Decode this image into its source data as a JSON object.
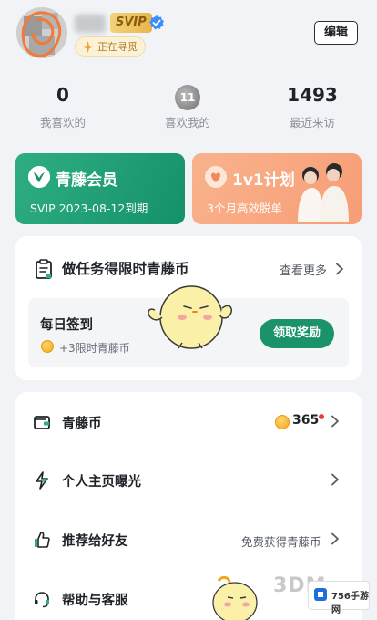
{
  "header": {
    "badge": "SVIP",
    "status": "正在寻觅",
    "edit_label": "编辑"
  },
  "stats": [
    {
      "value": "0",
      "label": "我喜欢的"
    },
    {
      "value": "11",
      "label": "喜欢我的"
    },
    {
      "value": "1493",
      "label": "最近来访"
    }
  ],
  "cards": {
    "membership": {
      "title": "青藤会员",
      "subtitle": "SVIP 2023-08-12到期"
    },
    "plan": {
      "title": "1v1计划",
      "subtitle": "3个月高效脱单"
    }
  },
  "tasks": {
    "title": "做任务得限时青藤币",
    "more": "查看更多",
    "signin_title": "每日签到",
    "signin_reward": "+3限时青藤币",
    "claim_button": "领取奖励"
  },
  "menu": [
    {
      "label": "青藤币",
      "right": "365",
      "icon": "wallet-icon"
    },
    {
      "label": "个人主页曝光",
      "right": "",
      "icon": "lightning-icon"
    },
    {
      "label": "推荐给好友",
      "right": "免费获得青藤币",
      "icon": "thumbs-up-icon"
    },
    {
      "label": "帮助与客服",
      "right": "",
      "icon": "headset-icon"
    }
  ],
  "watermark": {
    "text": "3DM",
    "site": "756手游网"
  },
  "colors": {
    "accent_green": "#1a936a",
    "promo_orange": "#f79d76",
    "badge_gold": "#e8b54a"
  }
}
